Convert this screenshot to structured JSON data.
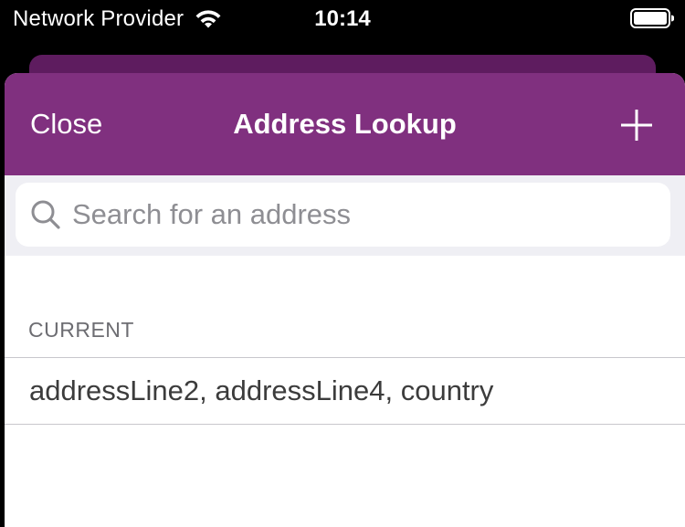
{
  "status_bar": {
    "carrier": "Network Provider",
    "time": "10:14"
  },
  "nav": {
    "close_label": "Close",
    "title": "Address Lookup",
    "add_icon": "plus-icon"
  },
  "search": {
    "placeholder": "Search for an address",
    "value": ""
  },
  "sections": {
    "current": {
      "header": "CURRENT",
      "items": [
        {
          "label": "addressLine2, addressLine4, country"
        }
      ]
    }
  },
  "colors": {
    "nav_background": "#80307f",
    "back_card": "#5e1c5f",
    "search_background": "#efeff4",
    "placeholder": "#8e8e93"
  }
}
